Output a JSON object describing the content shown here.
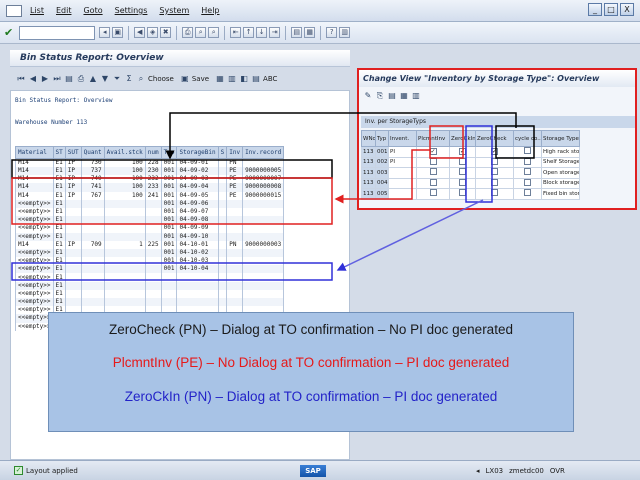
{
  "menubar": {
    "items": [
      "List",
      "Edit",
      "Goto",
      "Settings",
      "System",
      "Help"
    ],
    "window_buttons": [
      "_",
      "□",
      "X"
    ]
  },
  "main_title": "Bin Status Report: Overview",
  "app_toolbar": {
    "choose_label": "Choose",
    "save_label": "Save",
    "abc_label": "ABC"
  },
  "report": {
    "heading": "Bin Status Report: Overview",
    "warehouse_line": "Warehouse Number 113",
    "columns": [
      "Material",
      "ST",
      "SUT",
      "Quant",
      "Avail.stck",
      "num",
      "Typ",
      "StorageBin",
      "S",
      "Inv",
      "Inv.record"
    ],
    "rows": [
      [
        "M14",
        "E1",
        "IP",
        "730",
        "100",
        "228",
        "001",
        "04-09-01",
        "",
        "PN",
        ""
      ],
      [
        "M14",
        "E1",
        "IP",
        "737",
        "100",
        "230",
        "001",
        "04-09-02",
        "",
        "PE",
        "9000000005"
      ],
      [
        "M14",
        "E1",
        "IP",
        "740",
        "100",
        "232",
        "001",
        "04-09-03",
        "",
        "PE",
        "9000000007"
      ],
      [
        "M14",
        "E1",
        "IP",
        "741",
        "100",
        "233",
        "001",
        "04-09-04",
        "",
        "PE",
        "9000000008"
      ],
      [
        "M14",
        "E1",
        "IP",
        "767",
        "100",
        "241",
        "001",
        "04-09-05",
        "",
        "PE",
        "9000000015"
      ],
      [
        "<<empty>>",
        "E1",
        "",
        "",
        "",
        "",
        "001",
        "04-09-06",
        "",
        "",
        ""
      ],
      [
        "<<empty>>",
        "E1",
        "",
        "",
        "",
        "",
        "001",
        "04-09-07",
        "",
        "",
        ""
      ],
      [
        "<<empty>>",
        "E1",
        "",
        "",
        "",
        "",
        "001",
        "04-09-08",
        "",
        "",
        ""
      ],
      [
        "<<empty>>",
        "E1",
        "",
        "",
        "",
        "",
        "001",
        "04-09-09",
        "",
        "",
        ""
      ],
      [
        "<<empty>>",
        "E1",
        "",
        "",
        "",
        "",
        "001",
        "04-09-10",
        "",
        "",
        ""
      ],
      [
        "M14",
        "E1",
        "IP",
        "709",
        "1",
        "225",
        "001",
        "04-10-01",
        "",
        "PN",
        "9000000003"
      ],
      [
        "<<empty>>",
        "E1",
        "",
        "",
        "",
        "",
        "001",
        "04-10-02",
        "",
        "",
        ""
      ],
      [
        "<<empty>>",
        "E1",
        "",
        "",
        "",
        "",
        "001",
        "04-10-03",
        "",
        "",
        ""
      ],
      [
        "<<empty>>",
        "E1",
        "",
        "",
        "",
        "",
        "001",
        "04-10-04",
        "",
        "",
        ""
      ],
      [
        "<<empty>>",
        "E1",
        "",
        "",
        "",
        "",
        "",
        "",
        "",
        "",
        ""
      ],
      [
        "<<empty>>",
        "E1",
        "",
        "",
        "",
        "",
        "",
        "",
        "",
        "",
        ""
      ],
      [
        "<<empty>>",
        "E1",
        "",
        "",
        "",
        "",
        "",
        "",
        "",
        "",
        ""
      ],
      [
        "<<empty>>",
        "E1",
        "",
        "",
        "",
        "",
        "",
        "",
        "",
        "",
        ""
      ],
      [
        "<<empty>>",
        "E1",
        "",
        "",
        "",
        "",
        "",
        "",
        "",
        "",
        ""
      ],
      [
        "<<empty>>",
        "E1",
        "",
        "",
        "",
        "",
        "",
        "",
        "",
        "",
        ""
      ],
      [
        "<<empty>>",
        "E1",
        "",
        "",
        "",
        "",
        "",
        "",
        "",
        "",
        ""
      ]
    ]
  },
  "popup": {
    "title": "Change View \"Inventory by Storage Type\": Overview",
    "subheading": "Inv. per StorageTyps",
    "columns": [
      "WNo",
      "Typ",
      "Invent.",
      "PlcmntInv",
      "ZeroCkIn",
      "ZeroCheck",
      "cycle co...",
      "Storage Type"
    ],
    "rows": [
      {
        "wno": "113",
        "typ": "001",
        "inv": "PI",
        "plc": true,
        "zin": true,
        "zch": true,
        "cyc": false,
        "name": "High rack stor..."
      },
      {
        "wno": "113",
        "typ": "002",
        "inv": "PI",
        "plc": false,
        "zin": false,
        "zch": false,
        "cyc": false,
        "name": "Shelf Storage"
      },
      {
        "wno": "113",
        "typ": "003",
        "inv": "",
        "plc": false,
        "zin": false,
        "zch": false,
        "cyc": false,
        "name": "Open storage"
      },
      {
        "wno": "113",
        "typ": "004",
        "inv": "",
        "plc": false,
        "zin": false,
        "zch": false,
        "cyc": false,
        "name": "Block storage"
      },
      {
        "wno": "113",
        "typ": "005",
        "inv": "",
        "plc": false,
        "zin": false,
        "zch": false,
        "cyc": false,
        "name": "Fixed bin stora..."
      }
    ]
  },
  "info": {
    "line1": "ZeroCheck (PN) – Dialog at TO confirmation – No PI doc generated",
    "line2": "PlcmntInv (PE) – No Dialog at TO confirmation – PI doc generated",
    "line3": "ZeroCkIn (PN) – Dialog at TO confirmation – PI doc generated"
  },
  "statusbar": {
    "layout": "Layout applied",
    "sap": "SAP",
    "tcode": "LX03",
    "server": "zmetdc00",
    "mode": "OVR"
  },
  "colors": {
    "annotation_red": "#e02020",
    "annotation_blue": "#3030d8",
    "annotation_black": "#000000",
    "info_bg": "#a8c3e6"
  }
}
